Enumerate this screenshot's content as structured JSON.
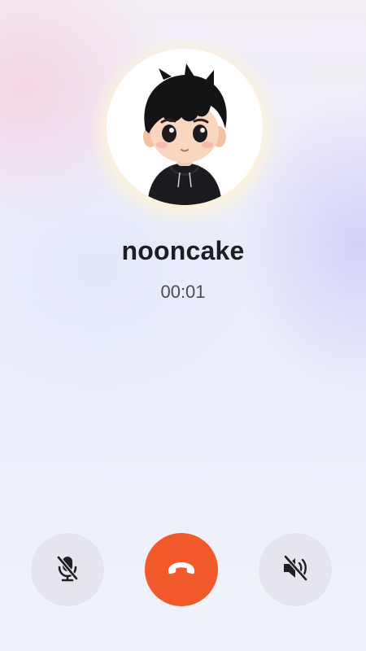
{
  "call": {
    "contact_name": "nooncake",
    "duration": "00:01"
  },
  "controls": {
    "mute": {
      "icon": "microphone-off-icon"
    },
    "hangup": {
      "icon": "phone-hangup-icon",
      "color": "#F2592B"
    },
    "speaker": {
      "icon": "speaker-off-icon"
    }
  },
  "colors": {
    "control_background": "#E5E6ED",
    "name_text": "#1D1E24",
    "timer_text": "#4B4D57"
  }
}
